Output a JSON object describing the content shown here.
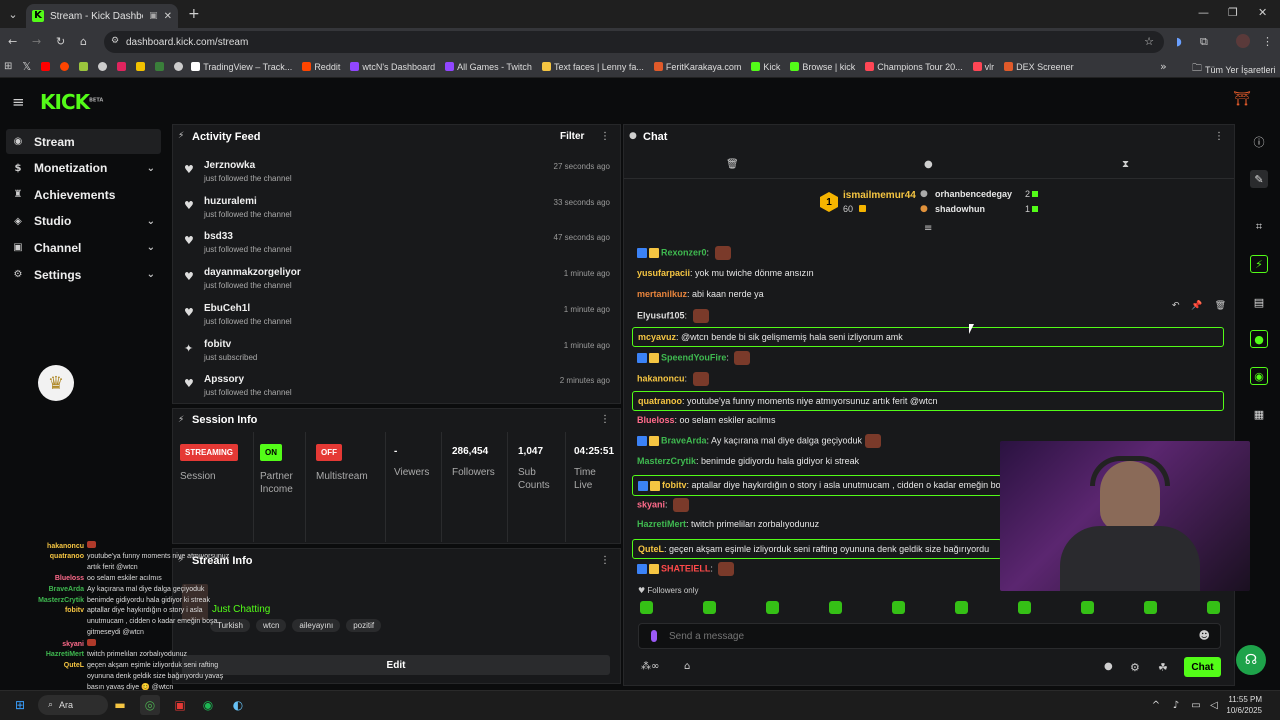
{
  "browser": {
    "tab_title": "Stream - Kick Dashboard",
    "url": "dashboard.kick.com/stream",
    "bookmarks": [
      {
        "label": "TradingView – Track...",
        "color": "#ffffff"
      },
      {
        "label": "Reddit",
        "color": "#ff4500"
      },
      {
        "label": "wtcN's Dashboard",
        "color": "#9146ff"
      },
      {
        "label": "All Games - Twitch",
        "color": "#9146ff"
      },
      {
        "label": "Text faces | Lenny fa...",
        "color": "#f5c542"
      },
      {
        "label": "FeritKarakaya.com",
        "color": "#e05a2a"
      },
      {
        "label": "Kick",
        "color": "#53fc18"
      },
      {
        "label": "Browse | kick",
        "color": "#53fc18"
      },
      {
        "label": "Champions Tour 20...",
        "color": "#ff4655"
      },
      {
        "label": "vlr",
        "color": "#ff4655"
      },
      {
        "label": "DEX Screener",
        "color": "#e05a2a"
      }
    ],
    "all_bookmarks": "Tüm Yer İşaretleri"
  },
  "header": {
    "logo": "KICK",
    "beta": "BETA"
  },
  "sidebar": {
    "items": [
      {
        "label": "Stream",
        "icon": "broadcast-icon",
        "has_chevron": false,
        "active": true
      },
      {
        "label": "Monetization",
        "icon": "dollar-icon",
        "has_chevron": true,
        "active": false
      },
      {
        "label": "Achievements",
        "icon": "trophy-icon",
        "has_chevron": false,
        "active": false
      },
      {
        "label": "Studio",
        "icon": "studio-icon",
        "has_chevron": true,
        "active": false
      },
      {
        "label": "Channel",
        "icon": "channel-icon",
        "has_chevron": true,
        "active": false
      },
      {
        "label": "Settings",
        "icon": "gear-icon",
        "has_chevron": true,
        "active": false
      }
    ]
  },
  "activity": {
    "title": "Activity Feed",
    "filter": "Filter",
    "items": [
      {
        "name": "Jerznowka",
        "action": "just followed the channel",
        "time": "27 seconds ago",
        "icon": "heart-icon"
      },
      {
        "name": "huzuralemi",
        "action": "just followed the channel",
        "time": "33 seconds ago",
        "icon": "heart-icon"
      },
      {
        "name": "bsd33",
        "action": "just followed the channel",
        "time": "47 seconds ago",
        "icon": "heart-icon"
      },
      {
        "name": "dayanmakzorgeliyor",
        "action": "just followed the channel",
        "time": "1 minute ago",
        "icon": "heart-icon"
      },
      {
        "name": "EbuCeh1l",
        "action": "just followed the channel",
        "time": "1 minute ago",
        "icon": "heart-icon"
      },
      {
        "name": "fobitv",
        "action": "just subscribed",
        "time": "1 minute ago",
        "icon": "sparkle-icon"
      },
      {
        "name": "Apssory",
        "action": "just followed the channel",
        "time": "2 minutes ago",
        "icon": "heart-icon"
      }
    ]
  },
  "session": {
    "title": "Session Info",
    "streaming": "STREAMING",
    "session_label": "Session",
    "on": "ON",
    "partner_label_1": "Partner",
    "partner_label_2": "Income",
    "off": "OFF",
    "multistream_label": "Multistream",
    "viewers_value": "-",
    "viewers_label": "Viewers",
    "followers_value": "286,454",
    "followers_label": "Followers",
    "subs_value": "1,047",
    "subs_label_1": "Sub",
    "subs_label_2": "Counts",
    "time_value": "04:25:51",
    "time_label_1": "Time",
    "time_label_2": "Live"
  },
  "stream_info": {
    "title": "Stream Info",
    "category": "Just Chatting",
    "tags": [
      "Turkish",
      "wtcn",
      "aileyayını",
      "pozitif"
    ],
    "edit": "Edit"
  },
  "chat": {
    "title": "Chat",
    "leaderboard": {
      "top_rank": "1",
      "top_name": "ismailmemur44",
      "top_count": "60",
      "others": [
        {
          "name": "orhanbencedegay",
          "count": "2"
        },
        {
          "name": "shadowhun",
          "count": "1"
        }
      ]
    },
    "messages": [
      {
        "user": "Rexonzer0",
        "color": "#3fb950",
        "text": "",
        "emote": true,
        "badges": true,
        "highlight": false
      },
      {
        "user": "yusufarpacii",
        "color": "#f5c542",
        "text": "yok mu twiche dönme ansızın",
        "emote": false,
        "badges": false,
        "highlight": false
      },
      {
        "user": "mertanilkuz",
        "color": "#e8843c",
        "text": "abi kaan nerde ya",
        "emote": false,
        "badges": false,
        "highlight": false
      },
      {
        "user": "Elyusuf105",
        "color": "#dddddd",
        "text": "",
        "emote": true,
        "badges": false,
        "highlight": false
      },
      {
        "user": "mcyavuz",
        "color": "#f5c542",
        "text": "@wtcn bende bi sik gelişmemiş hala seni izliyorum amk",
        "emote": false,
        "badges": false,
        "highlight": true
      },
      {
        "user": "SpeendYouFire",
        "color": "#3fb950",
        "text": "",
        "emote": true,
        "badges": true,
        "highlight": false
      },
      {
        "user": "hakanoncu",
        "color": "#f5c542",
        "text": "",
        "emote": true,
        "badges": false,
        "highlight": false
      },
      {
        "user": "quatranoo",
        "color": "#f5c542",
        "text": "youtube'ya funny moments niye atmıyorsunuz artık ferit @wtcn",
        "emote": false,
        "badges": false,
        "highlight": true
      },
      {
        "user": "Blueloss",
        "color": "#ff6b8b",
        "text": "oo selam eskiler acılmıs",
        "emote": false,
        "badges": false,
        "highlight": false
      },
      {
        "user": "BraveArda",
        "color": "#3fb950",
        "text": "Ay kaçırana mal diye dalga geçiyoduk",
        "emote": true,
        "badges": true,
        "highlight": false
      },
      {
        "user": "MasterzCrytik",
        "color": "#3fb950",
        "text": "benimde gidiyordu hala gidiyor ki streak",
        "emote": false,
        "badges": false,
        "highlight": false
      },
      {
        "user": "fobitv",
        "color": "#f5c542",
        "text": "aptallar diye haykırdığın o story i asla unutmucam , cidden o kadar emeğin boş",
        "emote": false,
        "badges": true,
        "highlight": true
      },
      {
        "user": "skyani",
        "color": "#ff6b8b",
        "text": "",
        "emote": true,
        "badges": false,
        "highlight": false
      },
      {
        "user": "HazretiMert",
        "color": "#3fb950",
        "text": "twitch primeliları zorbalıyodunuz",
        "emote": false,
        "badges": false,
        "highlight": false
      },
      {
        "user": "QuteL",
        "color": "#f5c542",
        "text": "geçen akşam eşimle izliyorduk seni rafting oyununa denk geldik size bağırıyordu",
        "emote": false,
        "badges": false,
        "highlight": true
      },
      {
        "user": "SHATEIELL",
        "color": "#ff4a4a",
        "text": "",
        "emote": true,
        "badges": true,
        "highlight": false
      }
    ],
    "followers_only": "Followers only",
    "placeholder": "Send a message",
    "send": "Chat"
  },
  "overlay": [
    {
      "n": "hakanoncu",
      "c": "#f5c542",
      "t": "",
      "e": true
    },
    {
      "n": "quatranoo",
      "c": "#f5c542",
      "t": "youtube'ya funny moments niye atmıyorsunuz",
      "e": false
    },
    {
      "n": "",
      "c": "#ffffff",
      "t": "artık ferit @wtcn",
      "e": false
    },
    {
      "n": "Blueloss",
      "c": "#ff6b8b",
      "t": "oo selam eskiler acılmıs",
      "e": false
    },
    {
      "n": "BraveArda",
      "c": "#3fb950",
      "t": "Ay kaçırana mal diye dalga geçiyoduk",
      "e": false
    },
    {
      "n": "MasterzCrytik",
      "c": "#3fb950",
      "t": "benimde gidiyordu hala gidiyor ki streak",
      "e": false
    },
    {
      "n": "fobitv",
      "c": "#f5c542",
      "t": "aptallar diye haykırdığın o story i asla",
      "e": false
    },
    {
      "n": "",
      "c": "#ffffff",
      "t": "unutmucam , cidden o kadar emeğin boşa",
      "e": false
    },
    {
      "n": "",
      "c": "#ffffff",
      "t": "gitmeseydi @wtcn",
      "e": false
    },
    {
      "n": "skyani",
      "c": "#ff6b8b",
      "t": "",
      "e": true
    },
    {
      "n": "HazretiMert",
      "c": "#3fb950",
      "t": "twitch primelıları zorbalıyodunuz",
      "e": false
    },
    {
      "n": "QuteL",
      "c": "#f5c542",
      "t": "geçen akşam eşimle izliyorduk seni rafting",
      "e": false
    },
    {
      "n": "",
      "c": "#ffffff",
      "t": "oyununa denk geldik size bağırıyordu yavaş",
      "e": false
    },
    {
      "n": "",
      "c": "#ffffff",
      "t": "basın yavaş diye 😊 @wtcn",
      "e": false
    }
  ],
  "taskbar": {
    "search": "Ara",
    "time": "11:55 PM",
    "date": "10/6/2025"
  },
  "colors": {
    "accent": "#53fc18",
    "streaming": "#e53935",
    "panel": "#18191b"
  }
}
